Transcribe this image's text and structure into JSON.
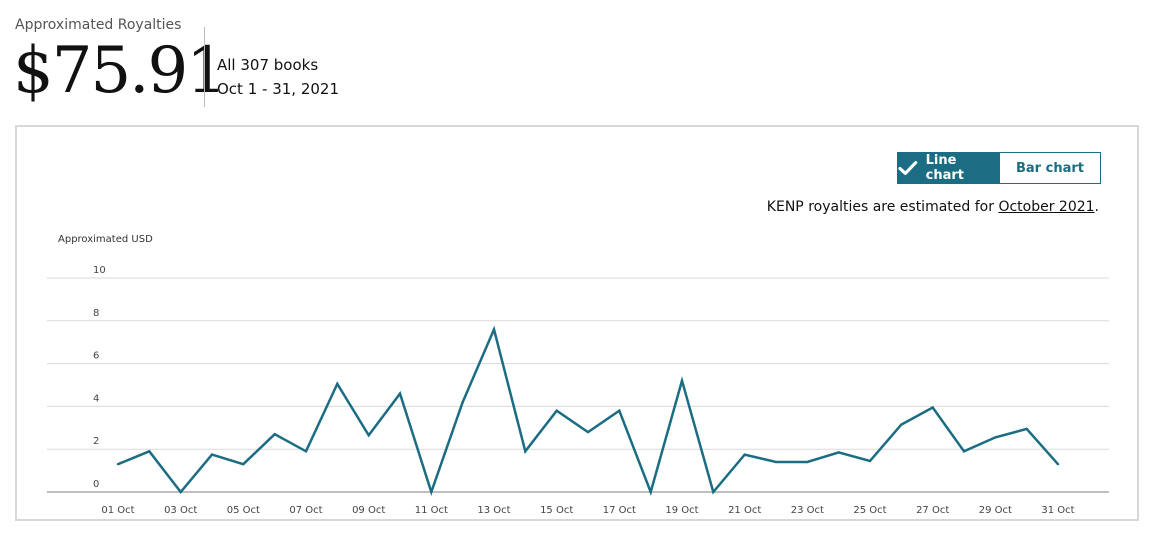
{
  "header": {
    "label": "Approximated Royalties",
    "amount": "$75.91",
    "scope": "All 307 books",
    "date_range": "Oct 1 - 31, 2021"
  },
  "toggle": {
    "line_label": "Line chart",
    "bar_label": "Bar chart",
    "selected": "line"
  },
  "note": {
    "prefix": "KENP royalties are estimated for ",
    "link": "October 2021",
    "suffix": "."
  },
  "colors": {
    "accent": "#1a6d82",
    "grid": "#d9d9d9"
  },
  "chart_data": {
    "type": "line",
    "ylabel": "Approximated USD",
    "ylim": [
      0,
      10
    ],
    "yticks": [
      0,
      2,
      4,
      6,
      8,
      10
    ],
    "x": [
      1,
      2,
      3,
      4,
      5,
      6,
      7,
      8,
      9,
      10,
      11,
      12,
      13,
      14,
      15,
      16,
      17,
      18,
      19,
      20,
      21,
      22,
      23,
      24,
      25,
      26,
      27,
      28,
      29,
      30,
      31
    ],
    "xtick_labels": [
      "01 Oct",
      "03 Oct",
      "05 Oct",
      "07 Oct",
      "09 Oct",
      "11 Oct",
      "13 Oct",
      "15 Oct",
      "17 Oct",
      "19 Oct",
      "21 Oct",
      "23 Oct",
      "25 Oct",
      "27 Oct",
      "29 Oct",
      "31 Oct"
    ],
    "xtick_positions": [
      1,
      3,
      5,
      7,
      9,
      11,
      13,
      15,
      17,
      19,
      21,
      23,
      25,
      27,
      29,
      31
    ],
    "series": [
      {
        "values": [
          1.3,
          1.9,
          0,
          1.75,
          1.3,
          2.7,
          1.9,
          5.05,
          2.65,
          4.6,
          0,
          4.2,
          7.6,
          1.9,
          3.8,
          2.8,
          3.8,
          0,
          5.2,
          0,
          1.75,
          1.4,
          1.4,
          1.85,
          1.45,
          3.15,
          3.95,
          1.9,
          2.55,
          2.95,
          1.3
        ]
      }
    ],
    "grid": true,
    "legend": "none"
  }
}
